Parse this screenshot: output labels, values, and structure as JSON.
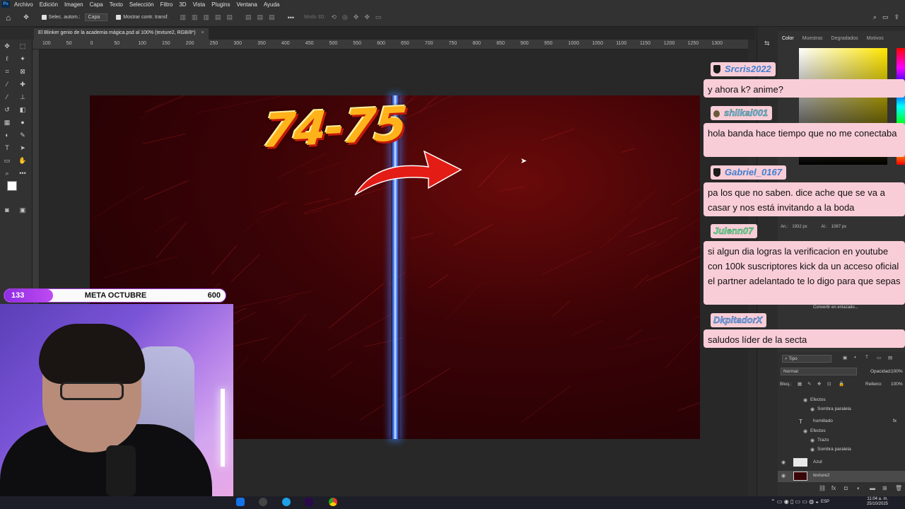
{
  "menubar": {
    "logo": "Ps",
    "items": [
      "Archivo",
      "Edición",
      "Imagen",
      "Capa",
      "Texto",
      "Selección",
      "Filtro",
      "3D",
      "Vista",
      "Plugins",
      "Ventana",
      "Ayuda"
    ]
  },
  "options": {
    "auto_select_label": "Selec. autom.:",
    "layer_select_value": "Capa",
    "show_transform_label": "Mostrar contr. transf.",
    "mode_3d_label": "Modo 3D:"
  },
  "document": {
    "tab_title": "El Blinker genio de la academia mágica.psd al 100% (texture2, RGB/8*)",
    "close_glyph": "×"
  },
  "ruler": {
    "top_labels": [
      "100",
      "50",
      "0",
      "50",
      "100",
      "150",
      "200",
      "250",
      "300",
      "350",
      "400",
      "450",
      "500",
      "550",
      "600",
      "650",
      "700",
      "750",
      "800",
      "850",
      "900",
      "950",
      "1000",
      "1050",
      "1100",
      "1150",
      "1200",
      "1250",
      "1300"
    ]
  },
  "canvas": {
    "headline": "74-75"
  },
  "color_panel": {
    "tabs": [
      "Color",
      "Muestras",
      "Degradados",
      "Motivos"
    ],
    "size_w_label": "An.:",
    "size_w_value": "1932 px",
    "size_h_label": "Al.:",
    "size_h_value": "1087 px",
    "convert_label": "Convertir en enlazado..."
  },
  "layers_panel": {
    "filter_label": "Tipo",
    "blend_mode": "Normal",
    "opacity_label": "Opacidad:",
    "opacity_value": "100%",
    "lock_label": "Bloq.:",
    "fill_label": "Relleno:",
    "fill_value": "100%",
    "rows": [
      {
        "label": "Efectos",
        "kind": "effects"
      },
      {
        "label": "Sombra paralela",
        "kind": "effect"
      },
      {
        "label": "humillado",
        "kind": "text-layer"
      },
      {
        "label": "Efectos",
        "kind": "effects"
      },
      {
        "label": "Trazo",
        "kind": "effect"
      },
      {
        "label": "Sombra paralela",
        "kind": "effect"
      },
      {
        "label": "Azul",
        "kind": "layer"
      },
      {
        "label": "texture2",
        "kind": "layer"
      }
    ]
  },
  "chat": [
    {
      "user": "Srcris2022",
      "message": "y ahora k? anime?"
    },
    {
      "user": "shilkai001",
      "message": "hola banda hace tiempo que no me conectaba"
    },
    {
      "user": "Gabriel_0167",
      "message": "pa los que no saben. dice ache que se va a casar y nos está invitando a la boda"
    },
    {
      "user": "Julenn07",
      "message": "si algun dia logras la verificacion en youtube con 100k suscriptores kick da un acceso oficial el partner adelantado te lo digo para que sepas"
    },
    {
      "user": "DkpitadorX",
      "message": "saludos líder de la secta"
    }
  ],
  "goal": {
    "current": "133",
    "title": "META OCTUBRE",
    "target": "600",
    "progress_fraction": 0.2217
  },
  "taskbar": {
    "lang": "ESP",
    "time": "11:04 a. m.",
    "date": "25/10/2025"
  },
  "colors": {
    "chat_bg": "#f9cdd7",
    "goal_purple": "#8e2de2",
    "canvas_red": "#3c0306",
    "lightning_blue": "#3a7bff"
  }
}
